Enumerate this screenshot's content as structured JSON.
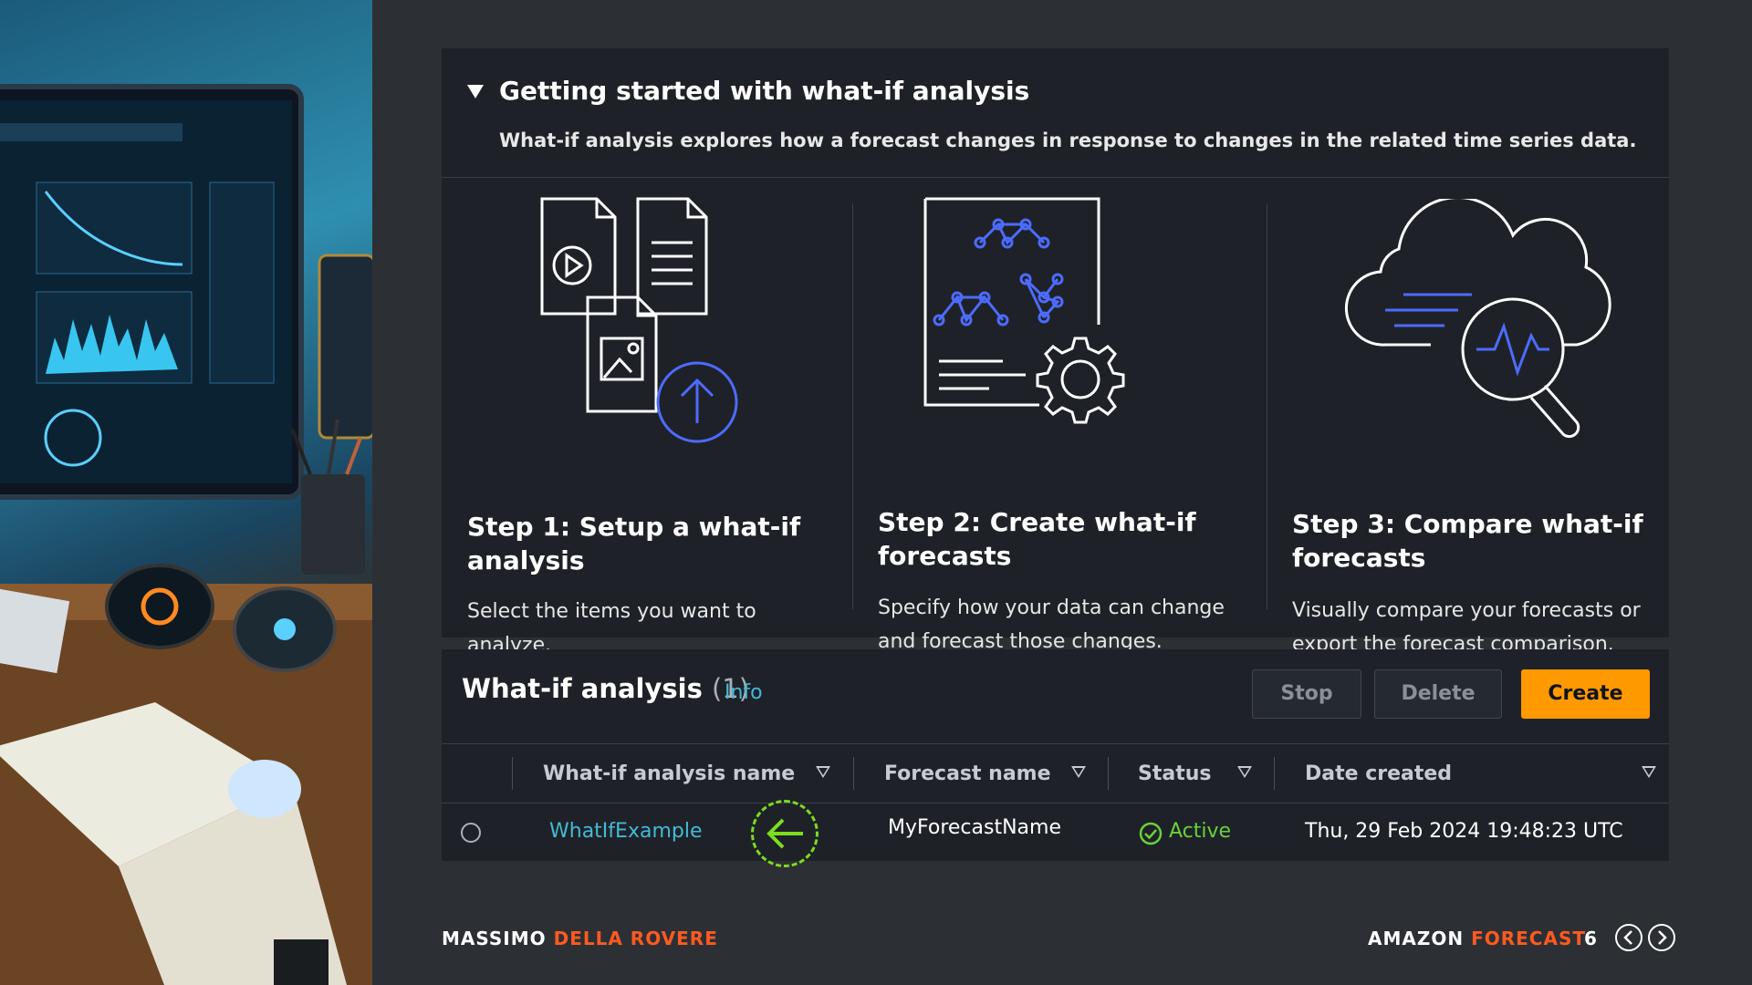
{
  "getting_started": {
    "title": "Getting started with what-if analysis",
    "description": "What-if analysis explores how a forecast changes in response to changes in the related time series data.",
    "steps": [
      {
        "title": "Step 1: Setup a what-if analysis",
        "text": "Select the items you want to analyze."
      },
      {
        "title": "Step 2: Create what-if forecasts",
        "text": "Specify how your data can change and forecast those changes."
      },
      {
        "title": "Step 3: Compare what-if forecasts",
        "text": "Visually compare your forecasts or export the forecast comparison."
      }
    ]
  },
  "table_panel": {
    "title": "What-if analysis",
    "count": "(1)",
    "info_link": "Info",
    "buttons": {
      "stop": "Stop",
      "delete": "Delete",
      "create": "Create"
    },
    "columns": [
      "What-if analysis name",
      "Forecast name",
      "Status",
      "Date created"
    ],
    "rows": [
      {
        "name": "WhatIfExample",
        "forecast": "MyForecastName",
        "status": "Active",
        "date": "Thu, 29 Feb 2024 19:48:23 UTC"
      }
    ]
  },
  "footer": {
    "author_first": "MASSIMO",
    "author_last": "DELLA ROVERE",
    "brand_first": "AMAZON",
    "brand_last": "FORECAST",
    "page": "6"
  },
  "colors": {
    "accent": "#ff5a1f",
    "create_button": "#ff9900",
    "link": "#44b9d6",
    "status_active": "#6bd13a",
    "icon_blue": "#4d6bfe"
  }
}
